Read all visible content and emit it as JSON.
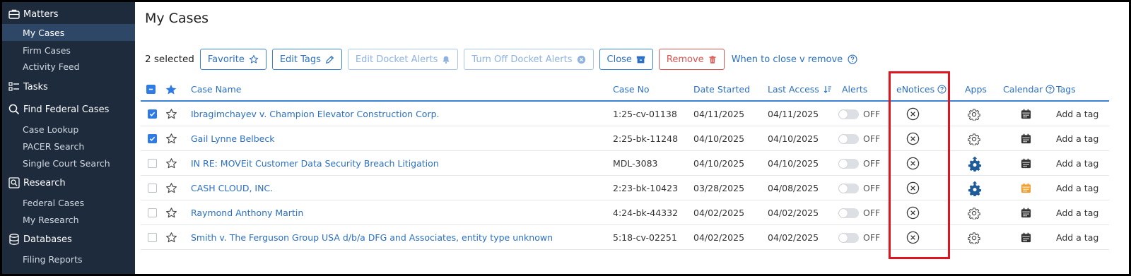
{
  "sidebar": {
    "sections": [
      {
        "label": "Matters",
        "icon": "briefcase-icon"
      },
      {
        "label": "Tasks",
        "icon": "tasks-icon"
      },
      {
        "label": "Find Federal Cases",
        "icon": "search-icon"
      },
      {
        "label": "Research",
        "icon": "research-icon"
      },
      {
        "label": "Databases",
        "icon": "database-icon"
      }
    ],
    "items": {
      "my_cases": "My Cases",
      "firm_cases": "Firm Cases",
      "activity_feed": "Activity Feed",
      "case_lookup": "Case Lookup",
      "pacer_search": "PACER Search",
      "single_court_search": "Single Court Search",
      "federal_cases": "Federal Cases",
      "my_research": "My Research",
      "filing_reports": "Filing Reports"
    }
  },
  "page_title": "My Cases",
  "toolbar": {
    "selected_count": "2 selected",
    "favorite": "Favorite",
    "edit_tags": "Edit Tags",
    "edit_docket_alerts": "Edit Docket Alerts",
    "turn_off_docket_alerts": "Turn Off Docket Alerts",
    "close": "Close",
    "remove": "Remove",
    "close_vs_remove_link": "When to close v remove"
  },
  "table": {
    "headers": {
      "case_name": "Case Name",
      "case_no": "Case No",
      "date_started": "Date Started",
      "last_access": "Last Access",
      "alerts": "Alerts",
      "enotices": "eNotices",
      "apps": "Apps",
      "calendar": "Calendar",
      "tags": "Tags"
    },
    "rows": [
      {
        "checked": true,
        "case_name": "Ibragimchayev v. Champion Elevator Construction Corp.",
        "case_no": "1:25-cv-01138",
        "date_started": "04/11/2025",
        "last_access": "04/11/2025",
        "alert": "OFF",
        "app_icon": "gear-icon",
        "calendar_icon": "calendar-icon",
        "tag": "Add a tag"
      },
      {
        "checked": true,
        "case_name": "Gail Lynne Belbeck",
        "case_no": "2:25-bk-11248",
        "date_started": "04/10/2025",
        "last_access": "04/10/2025",
        "alert": "OFF",
        "app_icon": "gear-icon",
        "calendar_icon": "calendar-icon",
        "tag": "Add a tag"
      },
      {
        "checked": false,
        "case_name": "IN RE: MOVEit Customer Data Security Breach Litigation",
        "case_no": "MDL-3083",
        "date_started": "04/10/2025",
        "last_access": "04/10/2025",
        "alert": "OFF",
        "app_icon": "gear-upload-icon",
        "calendar_icon": "calendar-icon",
        "tag": "Add a tag"
      },
      {
        "checked": false,
        "case_name": "CASH CLOUD, INC.",
        "case_no": "2:23-bk-10423",
        "date_started": "03/28/2025",
        "last_access": "04/08/2025",
        "alert": "OFF",
        "app_icon": "gear-upload-icon",
        "calendar_icon": "calendar-highlight-icon",
        "tag": "Add a tag"
      },
      {
        "checked": false,
        "case_name": "Raymond Anthony Martin",
        "case_no": "4:24-bk-44332",
        "date_started": "04/02/2025",
        "last_access": "04/02/2025",
        "alert": "OFF",
        "app_icon": "gear-icon",
        "calendar_icon": "calendar-icon",
        "tag": "Add a tag"
      },
      {
        "checked": false,
        "case_name": "Smith v. The Ferguson Group USA d/b/a DFG and Associates, entity type unknown",
        "case_no": "5:18-cv-02251",
        "date_started": "04/02/2025",
        "last_access": "04/02/2025",
        "alert": "OFF",
        "app_icon": "gear-icon",
        "calendar_icon": "calendar-icon",
        "tag": "Add a tag"
      }
    ]
  },
  "colors": {
    "sidebar_bg": "#1d2b3d",
    "sidebar_active": "#2f4766",
    "accent": "#2b6fc2",
    "danger": "#d9534f",
    "highlight_box": "#e0141e",
    "calendar_highlight": "#f0a030",
    "app_blue": "#1f5a99"
  }
}
